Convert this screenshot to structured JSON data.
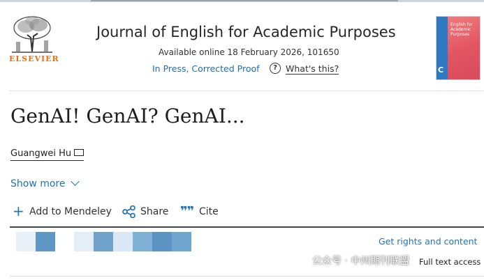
{
  "journal": {
    "name": "Journal of English for Academic Purposes",
    "availability": "Available online 18 February 2026, 101650",
    "status_link": "In Press, Corrected Proof",
    "help_label": "What's this?",
    "publisher": "ELSEVIER",
    "cover_title": "English for Academic Purposes"
  },
  "article": {
    "title": "GenAI! GenAI? GenAI...",
    "author": "Guangwei Hu",
    "show_more": "Show more"
  },
  "actions": {
    "mendeley": "Add to Mendeley",
    "share": "Share",
    "cite": "Cite"
  },
  "access": {
    "rights": "Get rights and content",
    "full_text": "Full text access"
  },
  "watermark": "公众号 · 中州期刊联盟",
  "colors": {
    "link": "#2373b6",
    "publisher_orange": "#e9711c",
    "tile_blues": [
      "#e8f1f8",
      "#5f98c6",
      "#d9e8f4",
      "#6fa3cc",
      "#a9c9e3",
      "#5b94c3",
      "#7fb0d6"
    ]
  },
  "icons": [
    "help-icon",
    "mail-icon",
    "chevron-down-icon",
    "plus-icon",
    "share-icon",
    "cite-icon"
  ]
}
